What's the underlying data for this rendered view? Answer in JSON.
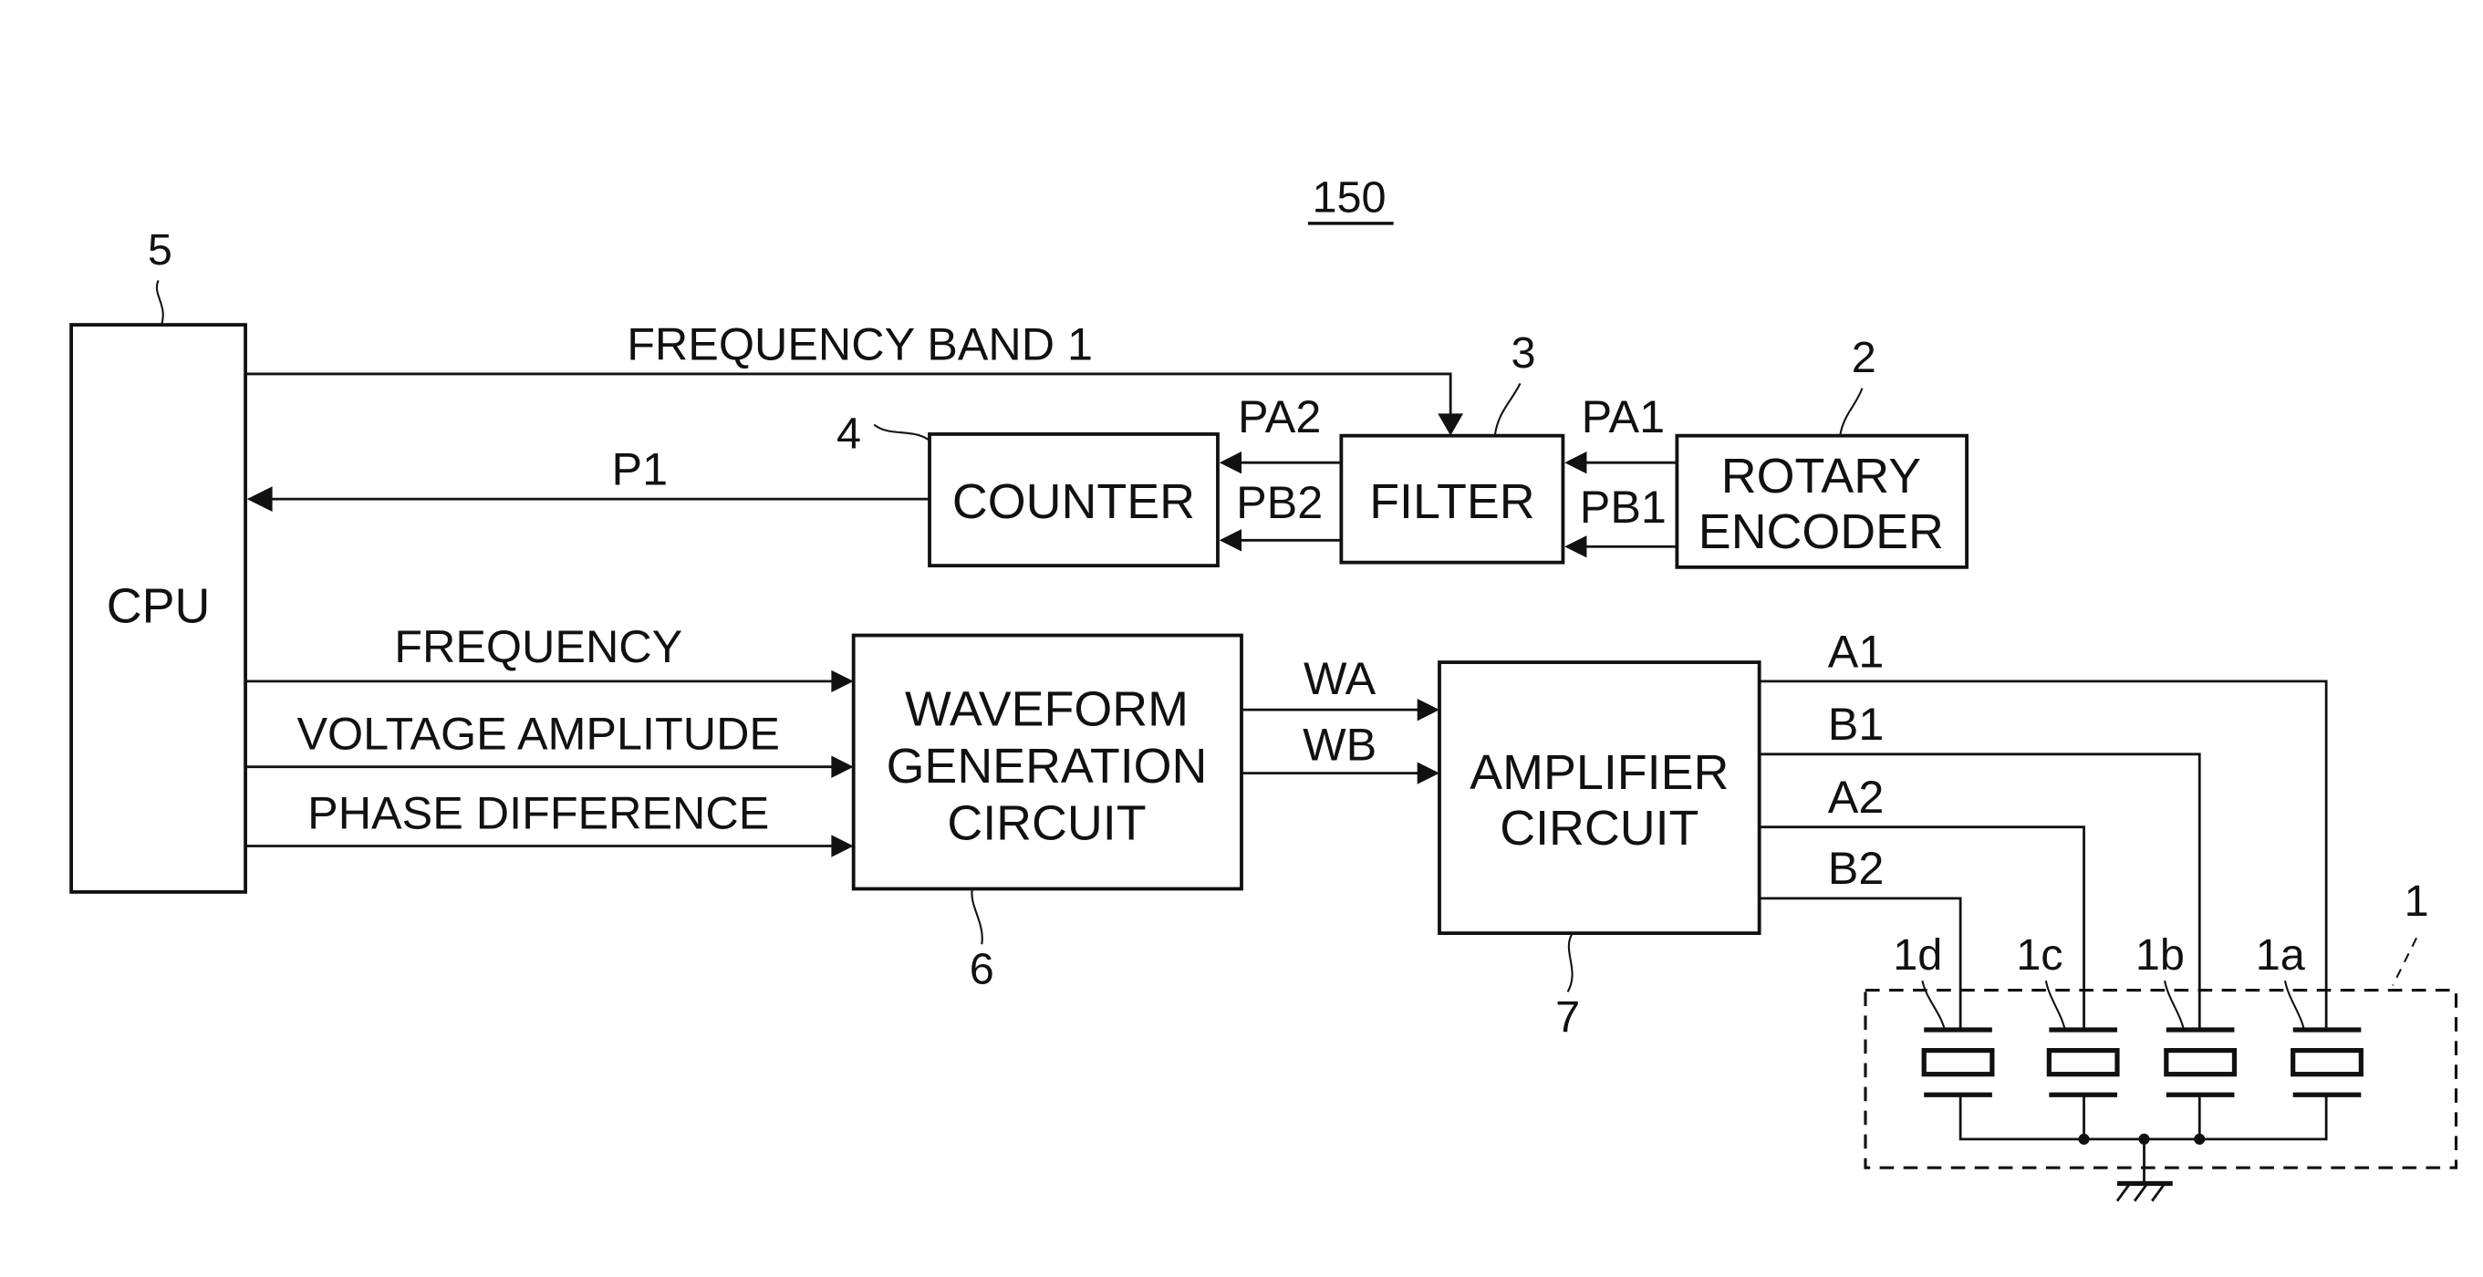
{
  "figure": {
    "reference": "150"
  },
  "blocks": {
    "cpu": {
      "ref": "5",
      "label": "CPU"
    },
    "rotary_encoder": {
      "ref": "2",
      "line1": "ROTARY",
      "line2": "ENCODER"
    },
    "filter": {
      "ref": "3",
      "label": "FILTER"
    },
    "counter": {
      "ref": "4",
      "label": "COUNTER"
    },
    "waveform": {
      "ref": "6",
      "line1": "WAVEFORM",
      "line2": "GENERATION",
      "line3": "CIRCUIT"
    },
    "amplifier": {
      "ref": "7",
      "line1": "AMPLIFIER",
      "line2": "CIRCUIT"
    },
    "vibrator": {
      "ref": "1"
    }
  },
  "signals": {
    "frequency_band": "FREQUENCY BAND 1",
    "p1": "P1",
    "pa1": "PA1",
    "pb1": "PB1",
    "pa2": "PA2",
    "pb2": "PB2",
    "frequency": "FREQUENCY",
    "voltage_amplitude": "VOLTAGE AMPLITUDE",
    "phase_difference": "PHASE DIFFERENCE",
    "wa": "WA",
    "wb": "WB",
    "a1": "A1",
    "b1": "B1",
    "a2": "A2",
    "b2": "B2"
  },
  "elements": [
    {
      "ref": "1d"
    },
    {
      "ref": "1c"
    },
    {
      "ref": "1b"
    },
    {
      "ref": "1a"
    }
  ],
  "icons": {
    "ground": "ground-symbol",
    "junction": "junction-dot"
  }
}
